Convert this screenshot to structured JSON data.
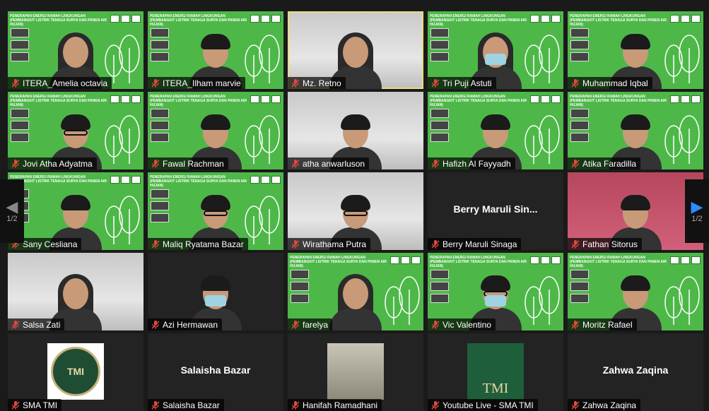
{
  "banner_text": "PENERAPAN ENERGI RAMAH LINGKUNGAN (PEMBANGKIT LISTRIK TENAGA SURYA DAN PANEN AIR HUJAN)",
  "pager": {
    "left_page": "1/2",
    "right_page": "1/2"
  },
  "tiles": [
    {
      "name": "ITERA_Amelia octavia",
      "bg": "green",
      "look": "hijab",
      "active": false
    },
    {
      "name": "ITERA_Ilham marvie",
      "bg": "green",
      "look": "hair",
      "active": false
    },
    {
      "name": "Mz. Retno",
      "bg": "room",
      "look": "hijab",
      "active": true
    },
    {
      "name": "Tri Puji Astuti",
      "bg": "green",
      "look": "hijab-mask",
      "active": false
    },
    {
      "name": "Muhammad Iqbal",
      "bg": "green",
      "look": "hair",
      "active": false
    },
    {
      "name": "Jovi Atha Adyatma",
      "bg": "green",
      "look": "glasses",
      "active": false
    },
    {
      "name": "Fawal Rachman",
      "bg": "green",
      "look": "hair",
      "active": false
    },
    {
      "name": "atha anwarluson",
      "bg": "room",
      "look": "hair",
      "active": false
    },
    {
      "name": "Hafizh Al Fayyadh",
      "bg": "green",
      "look": "hair",
      "active": false
    },
    {
      "name": "Atika Faradilla",
      "bg": "green",
      "look": "hair",
      "active": false
    },
    {
      "name": "Sany Cesliana",
      "bg": "green",
      "look": "hair",
      "active": false
    },
    {
      "name": "Maliq Ryatama Bazar",
      "bg": "green",
      "look": "glasses",
      "active": false
    },
    {
      "name": "Wirathama Putra",
      "bg": "room",
      "look": "glasses",
      "active": false
    },
    {
      "name": "Berry Maruli Sinaga",
      "center": "Berry  Maruli  Sin...",
      "bg": "dark",
      "look": "none",
      "active": false
    },
    {
      "name": "Fathan Sitorus",
      "bg": "pink",
      "look": "hair",
      "active": false
    },
    {
      "name": "Salsa Zati",
      "bg": "room",
      "look": "hijab",
      "active": false
    },
    {
      "name": "Azi Hermawan",
      "bg": "dark",
      "look": "hair-mask",
      "active": false
    },
    {
      "name": "farelya",
      "bg": "green",
      "look": "hijab",
      "active": false
    },
    {
      "name": "Vic Valentino",
      "bg": "green",
      "look": "glasses-mask",
      "active": false
    },
    {
      "name": "Moritz Rafael",
      "bg": "green",
      "look": "hair",
      "active": false
    },
    {
      "name": "SMA TMI",
      "bg": "dark",
      "look": "logo",
      "active": false
    },
    {
      "name": "Salaisha Bazar",
      "center": "Salaisha Bazar",
      "bg": "dark",
      "look": "none",
      "active": false
    },
    {
      "name": "Hanifah Ramadhani",
      "bg": "dark",
      "look": "photo",
      "active": false
    },
    {
      "name": "Youtube Live - SMA TMI",
      "logo_text": "TMI",
      "bg": "dark",
      "look": "tmi",
      "active": false
    },
    {
      "name": "Zahwa Zaqina",
      "center": "Zahwa Zaqina",
      "bg": "dark",
      "look": "none",
      "active": false
    }
  ],
  "colors": {
    "active_border": "#e6e07a",
    "nav_arrow_active": "#2d8cff",
    "mic_muted": "#e04a3f",
    "banner_green": "#4db848"
  },
  "logo_text": "TMI"
}
